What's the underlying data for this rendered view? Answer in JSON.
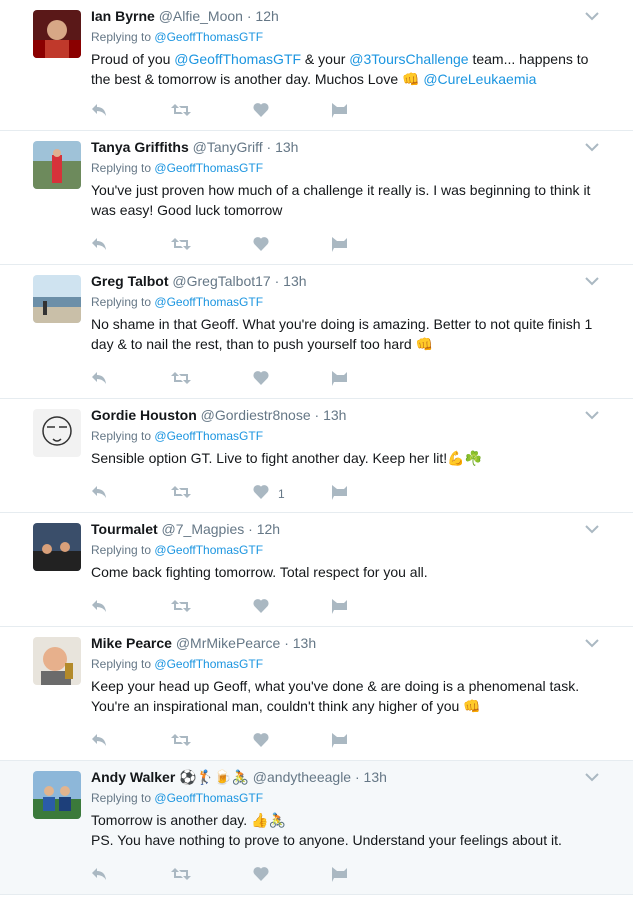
{
  "tweets": [
    {
      "name": "Ian Byrne",
      "handle": "@Alfie_Moon",
      "time": "12h",
      "replying_label": "Replying to",
      "replying_to": "@GeoffThomasGTF",
      "line1": [
        {
          "t": "Proud of you ",
          "link": false
        },
        {
          "t": "@GeoffThomasGTF",
          "link": true
        },
        {
          "t": " & your ",
          "link": false
        },
        {
          "t": "@3ToursChallenge",
          "link": true
        },
        {
          "t": " team...  happens to",
          "link": false
        }
      ],
      "line2": [
        {
          "t": "the best & tomorrow is another day. Muchos Love ",
          "link": false
        },
        {
          "t": "👊",
          "link": false
        },
        {
          "t": " ",
          "link": false
        },
        {
          "t": "@CureLeukaemia",
          "link": true
        }
      ],
      "likes": ""
    },
    {
      "name": "Tanya Griffiths",
      "handle": "@TanyGriff",
      "time": "13h",
      "replying_label": "Replying to",
      "replying_to": "@GeoffThomasGTF",
      "line1": [
        {
          "t": "You've just proven how much of a challenge it really is. I was beginning to think it",
          "link": false
        }
      ],
      "line2": [
        {
          "t": "was easy! Good luck tomorrow",
          "link": false
        }
      ],
      "likes": ""
    },
    {
      "name": "Greg Talbot",
      "handle": "@GregTalbot17",
      "time": "13h",
      "replying_label": "Replying to",
      "replying_to": "@GeoffThomasGTF",
      "line1": [
        {
          "t": "No shame in that Geoff. What you're doing is amazing. Better to not quite finish 1",
          "link": false
        }
      ],
      "line2": [
        {
          "t": "day & to nail the rest, than to push yourself too hard ",
          "link": false
        },
        {
          "t": "👊",
          "link": false
        }
      ],
      "likes": ""
    },
    {
      "name": "Gordie Houston",
      "handle": "@Gordiestr8nose",
      "time": "13h",
      "replying_label": "Replying to",
      "replying_to": "@GeoffThomasGTF",
      "line1": [
        {
          "t": "Sensible option GT. Live to fight another day. Keep her lit!",
          "link": false
        },
        {
          "t": "💪☘️",
          "link": false
        }
      ],
      "line2": [],
      "likes": "1"
    },
    {
      "name": "Tourmalet",
      "handle": "@7_Magpies",
      "time": "12h",
      "replying_label": "Replying to",
      "replying_to": "@GeoffThomasGTF",
      "line1": [
        {
          "t": "Come back fighting tomorrow.  Total respect for you all.",
          "link": false
        }
      ],
      "line2": [],
      "likes": ""
    },
    {
      "name": "Mike Pearce",
      "handle": "@MrMikePearce",
      "time": "13h",
      "replying_label": "Replying to",
      "replying_to": "@GeoffThomasGTF",
      "line1": [
        {
          "t": "Keep your head up Geoff, what you've done & are doing is a phenomenal task.",
          "link": false
        }
      ],
      "line2": [
        {
          "t": "You're an inspirational man, couldn't think any higher of you ",
          "link": false
        },
        {
          "t": "👊",
          "link": false
        }
      ],
      "likes": ""
    },
    {
      "name": "Andy Walker ⚽🏌🍺🚴",
      "handle": "@andytheeagle",
      "time": "13h",
      "replying_label": "Replying to",
      "replying_to": "@GeoffThomasGTF",
      "line1": [
        {
          "t": "Tomorrow is another day. ",
          "link": false
        },
        {
          "t": "👍🚴",
          "link": false
        }
      ],
      "line2": [
        {
          "t": "PS. You have nothing to prove to anyone. Understand your feelings about it.",
          "link": false
        }
      ],
      "likes": ""
    }
  ],
  "colors": {
    "link": "#1b95e0",
    "muted": "#657786",
    "icon": "#aab8c2",
    "border": "#e6ecf0"
  }
}
